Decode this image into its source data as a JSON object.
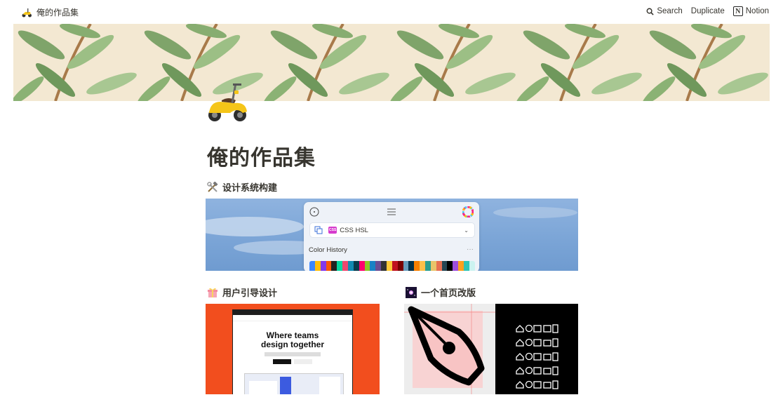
{
  "breadcrumb": {
    "title": "俺的作品集"
  },
  "topbar": {
    "search_label": "Search",
    "duplicate_label": "Duplicate",
    "notion_label": "Notion",
    "notion_glyph": "N"
  },
  "page": {
    "title": "俺的作品集"
  },
  "sections": [
    {
      "title": "设计系统构建",
      "icon": "hammer-wrench-icon"
    },
    {
      "title": "用户引导设计",
      "icon": "gift-icon"
    },
    {
      "title": "一个首页改版",
      "icon": "galaxy-icon"
    }
  ],
  "card1": {
    "select_label": "CSS HSL",
    "badge": "CSS",
    "history_label": "Color History",
    "more": "···",
    "swatches": [
      "#3a86ff",
      "#ffbe0b",
      "#8338ec",
      "#fb5607",
      "#222",
      "#06d6a0",
      "#ef476f",
      "#118ab2",
      "#073b4c",
      "#ff006e",
      "#8ac926",
      "#1982c4",
      "#6a4c93",
      "#333",
      "#ffca3a",
      "#c1121f",
      "#780000",
      "#669bbc",
      "#003049",
      "#f77f00",
      "#fcbf49",
      "#2a9d8f",
      "#e9c46a",
      "#e76f51",
      "#264653",
      "#000",
      "#9d4edd",
      "#ff9f1c",
      "#2ec4b6",
      "#cbf3f0"
    ]
  },
  "card2": {
    "headline1": "Where teams",
    "headline2": "design together"
  }
}
